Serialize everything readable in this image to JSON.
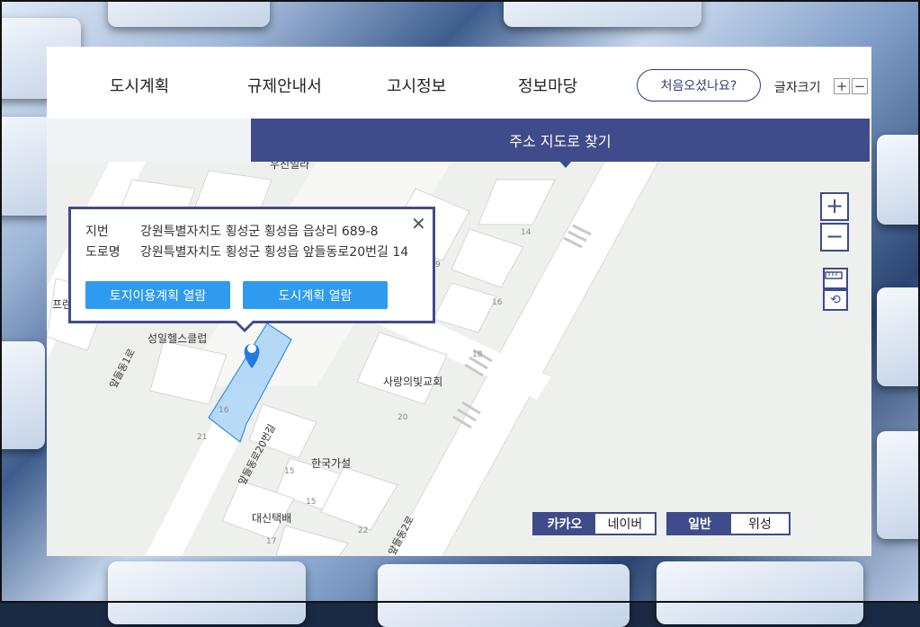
{
  "nav": {
    "items": [
      "도시계획",
      "규제안내서",
      "고시정보",
      "정보마당"
    ],
    "first_visit": "처음오셨나요?",
    "font_size_label": "글자크기",
    "font_plus": "+",
    "font_minus": "−"
  },
  "subbar": {
    "active_tab": "주소 지도로 찾기"
  },
  "popup": {
    "lot_label": "지번",
    "lot_value": "강원특별자치도 횡성군 횡성읍 읍상리 689-8",
    "road_label": "도로명",
    "road_value": "강원특별자치도 횡성군 횡성읍 앞들동로20번길 14",
    "land_use_button": "토지이용계획 열람",
    "urban_plan_button": "도시계획 열람",
    "close": "✕"
  },
  "map": {
    "labels": {
      "partial_top": "우진빌라",
      "partial_left": "프런",
      "gym": "성일헬스클럽",
      "church": "사랑의빛교회",
      "hanguk": "한국가설",
      "daesin": "대신택배",
      "road_apdeul1": "앞들동1로",
      "road_apdeul20": "앞들동로20번길",
      "road_apdeul2": "앞들동2로"
    },
    "lot_numbers": [
      "14",
      "9",
      "16",
      "18",
      "16",
      "20",
      "21",
      "15",
      "15",
      "22",
      "17",
      "26"
    ],
    "zoom_in": "+",
    "zoom_out": "−",
    "ruler_icon": "ruler-icon",
    "reset_icon": "reset-icon",
    "provider_toggle": {
      "selected": "카카오",
      "other": "네이버"
    },
    "type_toggle": {
      "selected": "일반",
      "other": "위성"
    },
    "colors": {
      "accent": "#3f4b8b",
      "button_blue": "#2e9bf0",
      "parcel_fill": "#9fcdf5"
    }
  }
}
